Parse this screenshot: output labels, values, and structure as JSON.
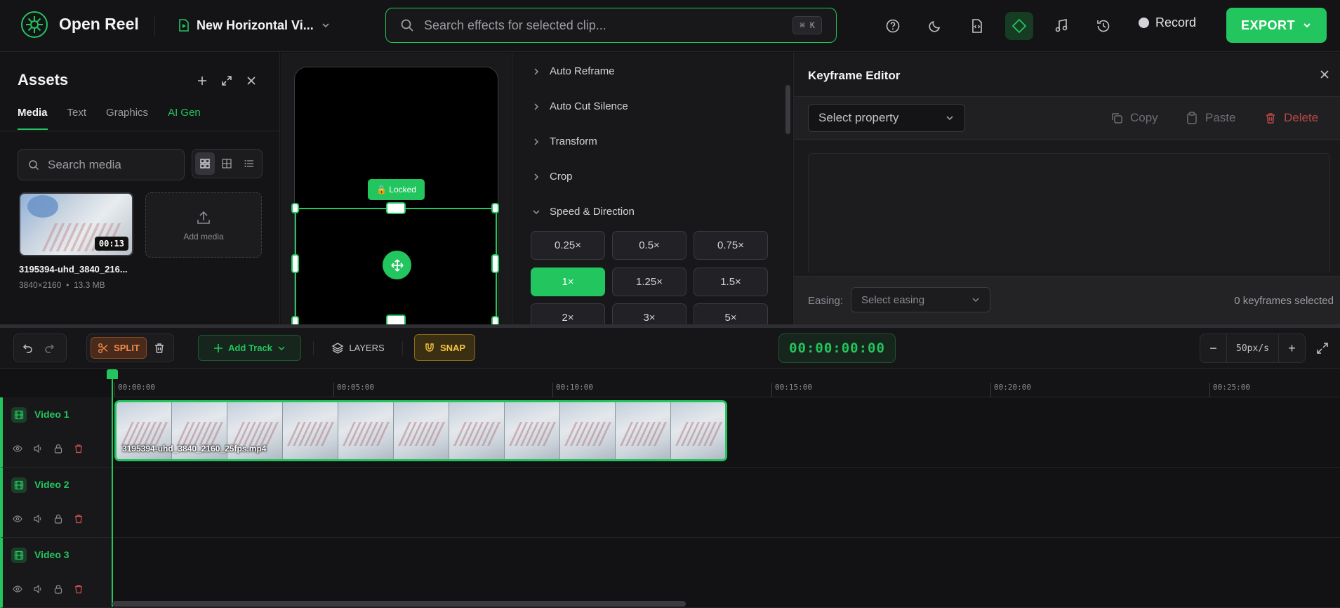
{
  "app": {
    "brand": "Open Reel",
    "project_name": "New Horizontal Vi...",
    "colors": {
      "accent": "#22c55e",
      "danger": "#b84747",
      "background": "#121214"
    }
  },
  "search": {
    "placeholder": "Search effects for selected clip...",
    "shortcut": "⌘ K"
  },
  "toolbar_icons": [
    "help-icon",
    "moon-icon",
    "code-file-icon",
    "keyframe-diamond-icon",
    "music-note-icon",
    "history-icon"
  ],
  "record": {
    "label": "Record"
  },
  "export": {
    "label": "EXPORT"
  },
  "assets": {
    "title": "Assets",
    "tabs": [
      "Media",
      "Text",
      "Graphics",
      "AI Gen"
    ],
    "active_tab": "Media",
    "search_placeholder": "Search media",
    "media": [
      {
        "name": "3195394-uhd_3840_216...",
        "duration": "00:13",
        "resolution": "3840×2160",
        "size": "13.3 MB"
      }
    ],
    "add_media_label": "Add media"
  },
  "preview": {
    "locked_label": "🔒 Locked"
  },
  "effects": {
    "sections": [
      "Auto Reframe",
      "Auto Cut Silence",
      "Transform",
      "Crop",
      "Speed & Direction"
    ],
    "expanded": "Speed & Direction",
    "speeds": [
      "0.25×",
      "0.5×",
      "0.75×",
      "1×",
      "1.25×",
      "1.5×",
      "2×",
      "3×",
      "5×"
    ],
    "selected_speed": "1×"
  },
  "keyframe_editor": {
    "title": "Keyframe Editor",
    "property_placeholder": "Select property",
    "copy_label": "Copy",
    "paste_label": "Paste",
    "delete_label": "Delete",
    "easing_label": "Easing:",
    "easing_placeholder": "Select easing",
    "selection_count": "0 keyframes selected"
  },
  "timeline_toolbar": {
    "split_label": "SPLIT",
    "add_track_label": "Add Track",
    "layers_label": "LAYERS",
    "snap_label": "SNAP",
    "timecode": "00:00:00:00",
    "zoom_minus": "−",
    "zoom_value": "50px/s",
    "zoom_plus": "+"
  },
  "timeline": {
    "ruler_ticks": [
      "00:00:00",
      "00:05:00",
      "00:10:00",
      "00:15:00",
      "00:20:00",
      "00:25:00"
    ],
    "tracks": [
      {
        "name": "Video 1"
      },
      {
        "name": "Video 2"
      },
      {
        "name": "Video 3"
      }
    ],
    "clip": {
      "name": "3195394-uhd_3840_2160_25fps.mp4"
    }
  }
}
